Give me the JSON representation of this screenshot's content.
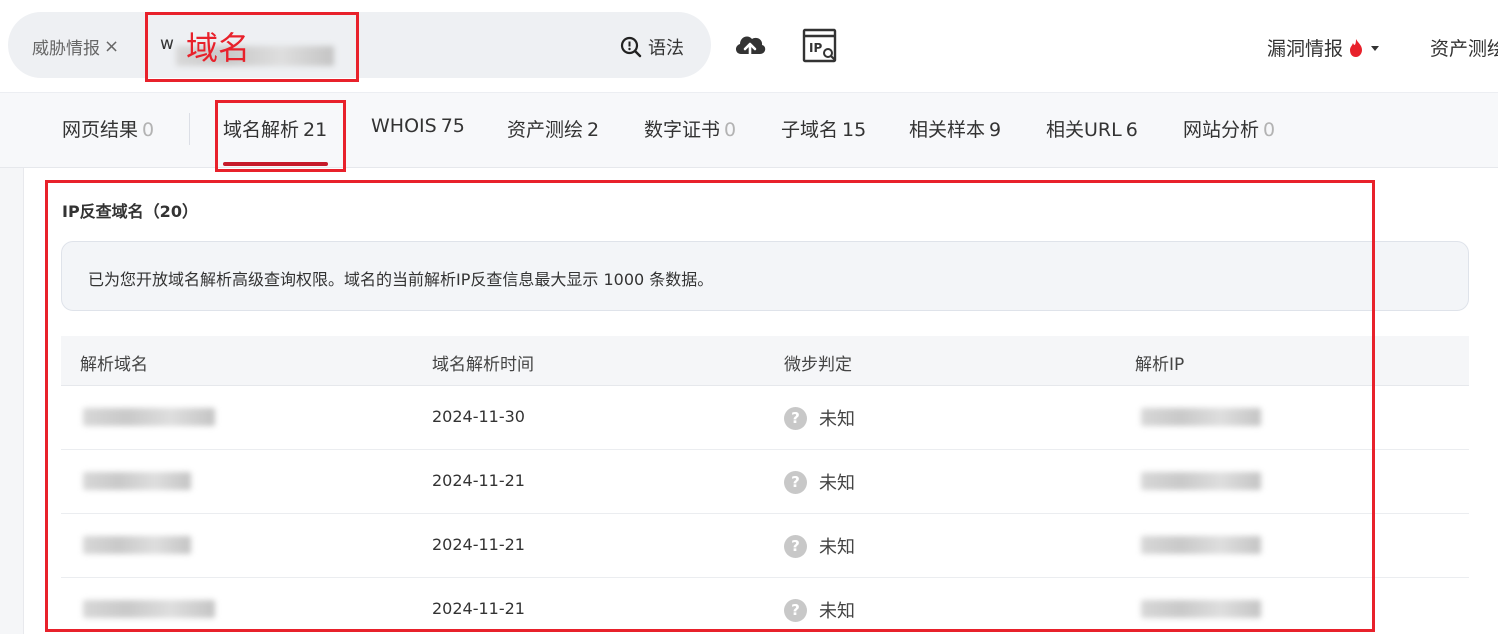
{
  "search": {
    "tag_label": "威胁情报",
    "tag_close": "×",
    "value_prefix": "w",
    "syntax_label": "语法"
  },
  "header": {
    "vuln_label": "漏洞情报",
    "asset_label": "资产测绘"
  },
  "annotation": {
    "domain_label": "域名"
  },
  "tabs": [
    {
      "label": "网页结果",
      "count": "0"
    },
    {
      "label": "域名解析",
      "count": "21"
    },
    {
      "label": "WHOIS",
      "count": "75"
    },
    {
      "label": "资产测绘",
      "count": "2"
    },
    {
      "label": "数字证书",
      "count": "0"
    },
    {
      "label": "子域名",
      "count": "15"
    },
    {
      "label": "相关样本",
      "count": "9"
    },
    {
      "label": "相关URL",
      "count": "6"
    },
    {
      "label": "网站分析",
      "count": "0"
    }
  ],
  "section": {
    "title": "IP反查域名（20）",
    "notice": "已为您开放域名解析高级查询权限。域名的当前解析IP反查信息最大显示 1000 条数据。"
  },
  "table": {
    "headers": [
      "解析域名",
      "域名解析时间",
      "微步判定",
      "解析IP"
    ],
    "rows": [
      {
        "time": "2024-11-30",
        "verdict": "未知"
      },
      {
        "time": "2024-11-21",
        "verdict": "未知"
      },
      {
        "time": "2024-11-21",
        "verdict": "未知"
      },
      {
        "time": "2024-11-21",
        "verdict": "未知"
      }
    ]
  },
  "colors": {
    "accent_red": "#c61a2a",
    "annotation_red": "#e8212b",
    "fire": "#e8212b"
  }
}
